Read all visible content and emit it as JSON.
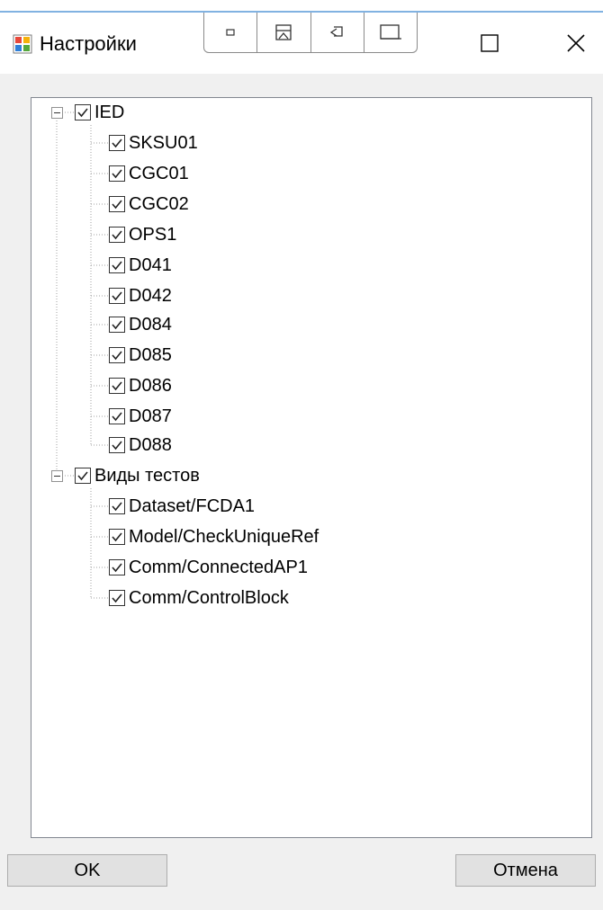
{
  "window": {
    "title": "Настройки",
    "icons": {
      "app": "app-icon",
      "maximize": "maximize-icon",
      "close": "close-icon"
    },
    "snap_layout_icons": [
      "snap-small-icon",
      "snap-top-icon",
      "snap-restore-icon",
      "snap-side-icon"
    ]
  },
  "tree": {
    "groups": [
      {
        "label": "IED",
        "checked": true,
        "expanded": true,
        "children": [
          {
            "label": "SKSU01",
            "checked": true
          },
          {
            "label": "CGC01",
            "checked": true
          },
          {
            "label": "CGC02",
            "checked": true
          },
          {
            "label": "OPS1",
            "checked": true
          },
          {
            "label": "D041",
            "checked": true
          },
          {
            "label": "D042",
            "checked": true
          },
          {
            "label": "D084",
            "checked": true
          },
          {
            "label": "D085",
            "checked": true
          },
          {
            "label": "D086",
            "checked": true
          },
          {
            "label": "D087",
            "checked": true
          },
          {
            "label": "D088",
            "checked": true
          }
        ]
      },
      {
        "label": "Виды тестов",
        "checked": true,
        "expanded": true,
        "children": [
          {
            "label": "Dataset/FCDA1",
            "checked": true
          },
          {
            "label": "Model/CheckUniqueRef",
            "checked": true
          },
          {
            "label": "Comm/ConnectedAP1",
            "checked": true
          },
          {
            "label": "Comm/ControlBlock",
            "checked": true
          }
        ]
      }
    ]
  },
  "buttons": {
    "ok": "OK",
    "cancel": "Отмена"
  }
}
